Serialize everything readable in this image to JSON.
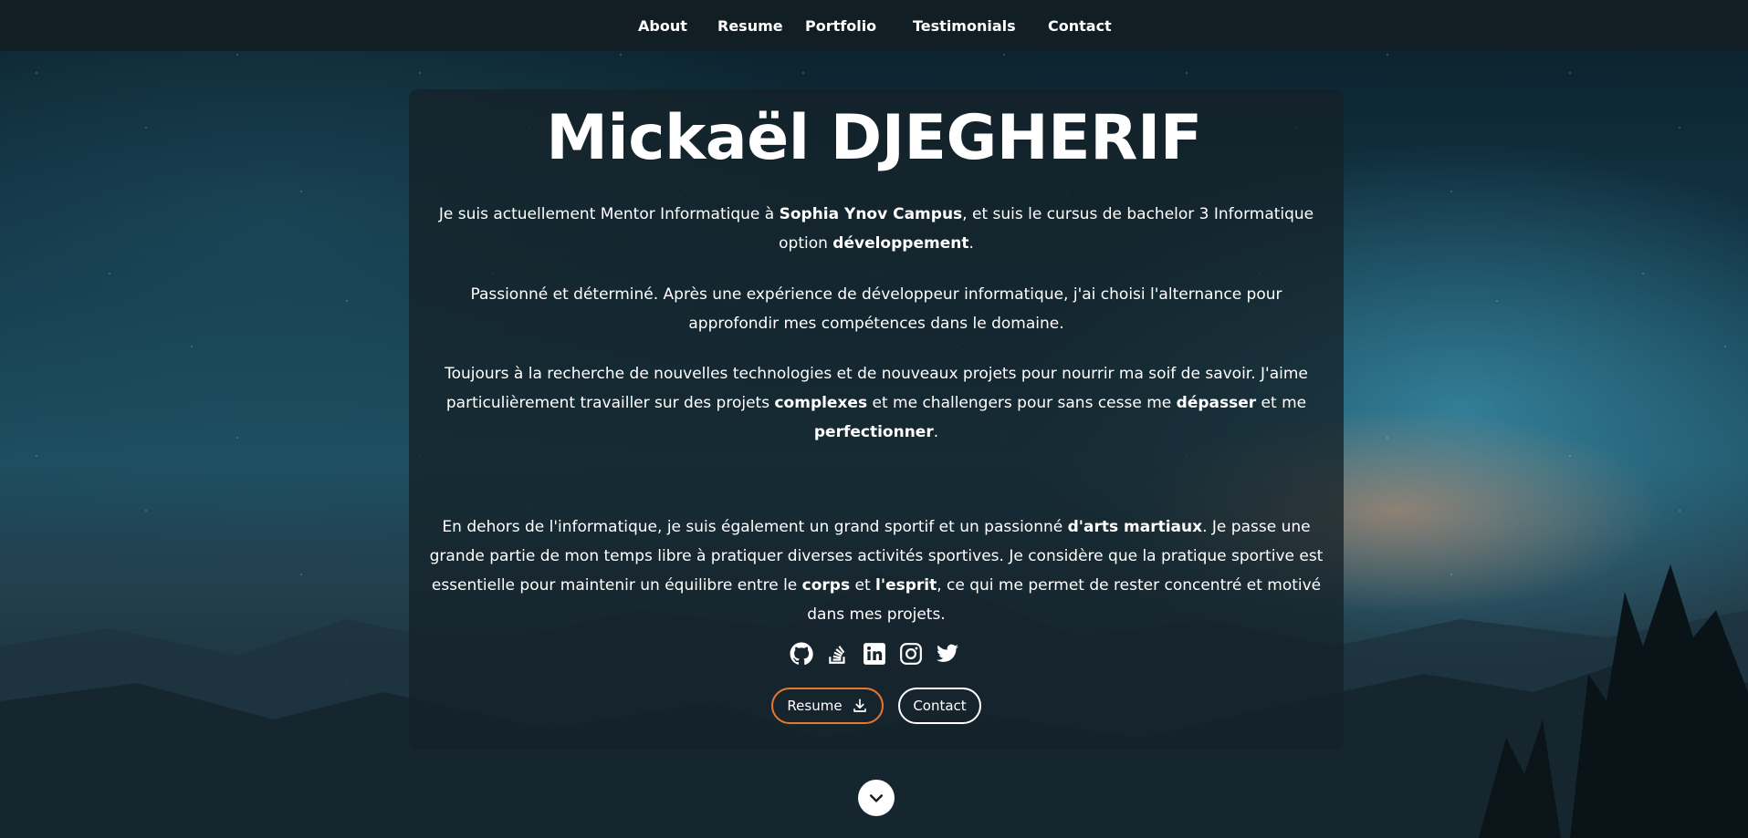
{
  "nav": {
    "items": [
      {
        "label": "About"
      },
      {
        "label": "Resume"
      },
      {
        "label": "Portfolio"
      },
      {
        "label": "Testimonials"
      },
      {
        "label": "Contact"
      }
    ]
  },
  "hero": {
    "name": "Mickaël DJEGHERIF",
    "p1": {
      "t1": "Je suis actuellement Mentor Informatique à ",
      "b1": "Sophia Ynov Campus",
      "t2": ", et suis le cursus de bachelor 3 Informatique option ",
      "b2": "développement",
      "t3": "."
    },
    "p2": "Passionné et déterminé. Après une expérience de développeur informatique, j'ai choisi l'alternance pour approfondir mes compétences dans le domaine.",
    "p3": {
      "t1": "Toujours à la recherche de nouvelles technologies et de nouveaux projets pour nourrir ma soif de savoir. J'aime particulièrement travailler sur des projets ",
      "b1": "complexes",
      "t2": " et me challengers pour sans cesse me ",
      "b2": "dépasser",
      "t3": " et me ",
      "b3": "perfectionner",
      "t4": "."
    },
    "p4": {
      "t1": "En dehors de l'informatique, je suis également un grand sportif et un passionné ",
      "b1": "d'arts martiaux",
      "t2": ". Je passe une grande partie de mon temps libre à pratiquer diverses activités sportives. Je considère que la pratique sportive est essentielle pour maintenir un équilibre entre le ",
      "b2": "corps",
      "t3": " et ",
      "b3": "l'esprit",
      "t4": ", ce qui me permet de rester concentré et motivé dans mes projets."
    },
    "socials": [
      "github-icon",
      "stackoverflow-icon",
      "linkedin-icon",
      "instagram-icon",
      "twitter-icon"
    ],
    "resume_button": "Resume",
    "contact_button": "Contact"
  },
  "colors": {
    "accent_orange": "#e8772e",
    "navbar_bg": "#121e24",
    "card_bg": "#142128"
  }
}
